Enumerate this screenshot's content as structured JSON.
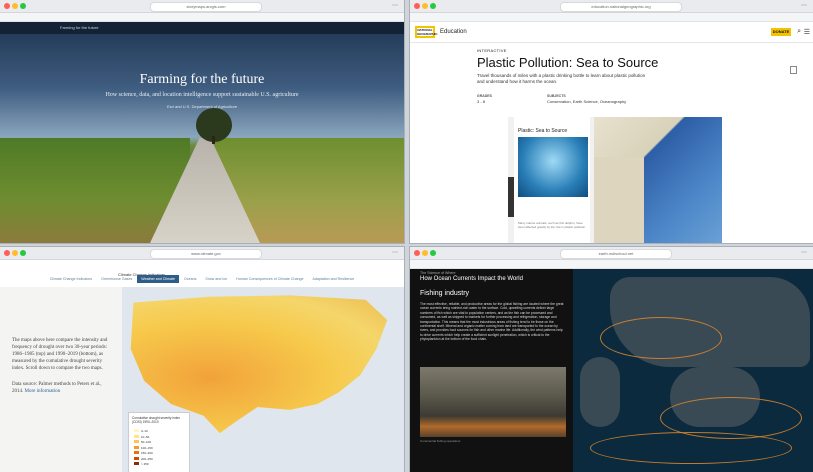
{
  "windows": {
    "w1": {
      "url": "storymaps.arcgis.com",
      "page_header": "Farming for the future",
      "title": "Farming for the future",
      "subtitle": "How science, data, and location intelligence support sustainable U.S. agriculture",
      "credit": "Esri and U.S. Department of Agriculture"
    },
    "w2": {
      "url": "education.nationalgeographic.org",
      "logo": "NATIONAL GEOGRAPHIC",
      "edu": "Education",
      "donate": "DONATE",
      "kicker": "INTERACTIVE",
      "title": "Plastic Pollution: Sea to Source",
      "description": "Travel thousands of miles with a plastic drinking bottle to learn about plastic pollution and understand how it harms the ocean.",
      "grades_label": "GRADES",
      "grades_value": "3 - 8",
      "subjects_label": "SUBJECTS",
      "subjects_value": "Conservation, Earth Science, Oceanography",
      "story_title": "Plastic: Sea to Source",
      "story_caption": "Many marine animals, such as this dolphin, have been affected greatly by the rise in plastic pollution."
    },
    "w3": {
      "url": "www.climate.gov",
      "site_title": "Climate Change Indicators",
      "tabs": [
        "Climate Change Indicators",
        "Greenhouse Gases",
        "Weather and Climate",
        "Oceans",
        "Snow and Ice",
        "Human Consequences of Climate Change",
        "Adaptation and Resilience"
      ],
      "active_tab": 2,
      "paragraph": "The maps above here compare the intensity and frequency of drought over two 30-year periods: 1986–1985 (top) and 1990–2019 (bottom), as measured by the cumulative drought severity index. Scroll down to compare the two maps.",
      "data_source": "Data source: Palmer methods to Peters et al., 2014.",
      "data_source_link": "More information",
      "legend_title": "Cumulative drought severity index (CDSI) 1990–2019",
      "legend_items": [
        "0–10",
        "10–50",
        "50–100",
        "100–150",
        "150–200",
        "200–250",
        "> 250"
      ],
      "legend_colors": [
        "#fff7bc",
        "#fee391",
        "#fec44f",
        "#fe9929",
        "#ec7014",
        "#cc4c02",
        "#8c2d04"
      ]
    },
    "w4": {
      "url": "earth.nullschool.net",
      "kicker": "The Science of Where",
      "title": "How Ocean Currents Impact the World",
      "section": "Fishing industry",
      "body": "The most effective, reliable, and productive areas for the global fishing are located where the great ocean currents bring nutrient-rich water to the surface. Cold, upwelling currents deliver large numbers of fish which are vital to population centers, and as the fish can be processed and consumed, as well as shipped to markets for further processing and refrigeration, storage and transportation. This means that the most industrious areas of fishing tend to be those on the continental shelf. Mineral and organic matter coming from land are transported to the ocean by rivers, and provides food sources for fish and other marine life. Additionally, the wind patterns help to drive currents which help create a sufficient sunlight penetration, which is critical to the phytoplankton at the bottom of the food chain.",
      "image_caption": "Commercial fishing operations"
    }
  },
  "colors": {
    "ng_yellow": "#f2c300",
    "climate_tab": "#2f5d8a",
    "current_line": "#e08a2c"
  }
}
